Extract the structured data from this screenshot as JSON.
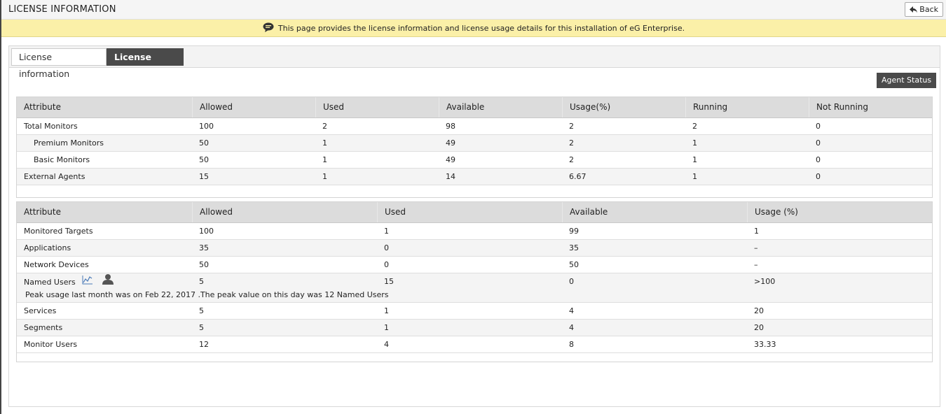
{
  "header": {
    "title": "LICENSE INFORMATION",
    "back_label": "Back"
  },
  "info_message": "This page provides the license information and license usage details for this installation of eG Enterprise.",
  "tabs": [
    {
      "label": "License information",
      "active": false
    },
    {
      "label": "License usage",
      "active": true
    }
  ],
  "agent_status_label": "Agent Status",
  "monitors_table": {
    "headers": [
      "Attribute",
      "Allowed",
      "Used",
      "Available",
      "Usage(%)",
      "Running",
      "Not Running"
    ],
    "rows": [
      [
        "Total Monitors",
        "100",
        "2",
        "98",
        "2",
        "2",
        "0"
      ],
      [
        "Premium Monitors",
        "50",
        "1",
        "49",
        "2",
        "1",
        "0"
      ],
      [
        "Basic Monitors",
        "50",
        "1",
        "49",
        "2",
        "1",
        "0"
      ],
      [
        "External Agents",
        "15",
        "1",
        "14",
        "6.67",
        "1",
        "0"
      ]
    ]
  },
  "targets_table": {
    "headers": [
      "Attribute",
      "Allowed",
      "Used",
      "Available",
      "Usage (%)"
    ],
    "rows": [
      [
        "Monitored Targets",
        "100",
        "1",
        "99",
        "1"
      ],
      [
        "Applications",
        "35",
        "0",
        "35",
        "–"
      ],
      [
        "Network Devices",
        "50",
        "0",
        "50",
        "–"
      ],
      [
        "Named Users",
        "5",
        "15",
        "0",
        ">100"
      ],
      [
        "Services",
        "5",
        "1",
        "4",
        "20"
      ],
      [
        "Segments",
        "5",
        "1",
        "4",
        "20"
      ],
      [
        "Monitor Users",
        "12",
        "4",
        "8",
        "33.33"
      ]
    ],
    "peak_note": "Peak usage last month was on Feb 22, 2017 .The peak value on this day was 12 Named Users"
  },
  "colors": {
    "info_bar": "#fbf0a8",
    "active_tab": "#4a4a4a",
    "header_row": "#dcdcdc"
  }
}
